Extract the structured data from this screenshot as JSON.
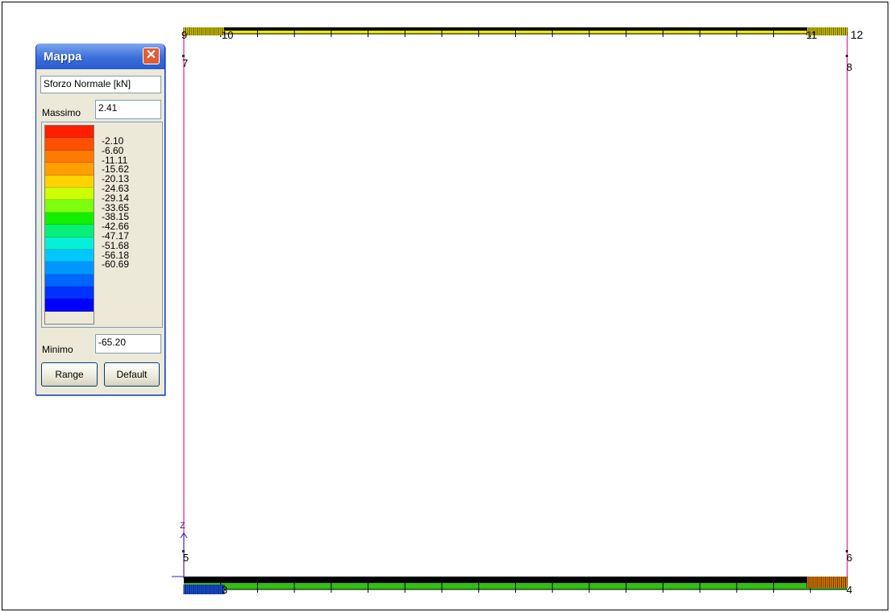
{
  "window": {
    "title": "Mappa",
    "close_label": "✕",
    "quantity": "Sforzo Normale [kN]",
    "max_label": "Massimo",
    "max_value": "2.41",
    "min_label": "Minimo",
    "min_value": "-65.20",
    "range_button": "Range",
    "default_button": "Default"
  },
  "legend": {
    "colors": [
      "#ff1e00",
      "#ff4f00",
      "#ff7a00",
      "#ffa000",
      "#ffd300",
      "#ccff00",
      "#7dff10",
      "#13ef00",
      "#06f07a",
      "#06f0d8",
      "#00c8ff",
      "#0096ff",
      "#0064ff",
      "#0032ff",
      "#0000ff"
    ],
    "values": [
      "-2.10",
      "-6.60",
      "-11.11",
      "-15.62",
      "-20.13",
      "-24.63",
      "-29.14",
      "-33.65",
      "-38.15",
      "-42.66",
      "-47.17",
      "-51.68",
      "-56.18",
      "-60.69"
    ]
  },
  "structure": {
    "node_labels": {
      "n9": "9",
      "n10": "10",
      "n11": "11",
      "n12": "12",
      "n7": "7",
      "n8": "8",
      "n5": "5",
      "n6": "6",
      "n3": "3",
      "n4": "4"
    },
    "axis_label": "Z",
    "colors": {
      "column": "#e0218a",
      "top_beam": "#f2e600",
      "bottom_beam": "#30c010",
      "hatch_top_left": "#f0e000",
      "hatch_top_right": "#f0e000",
      "hatch_bottom_left": "#1d5cff",
      "hatch_bottom_right": "#ff8a00",
      "axis": "#2a1fbf"
    }
  }
}
